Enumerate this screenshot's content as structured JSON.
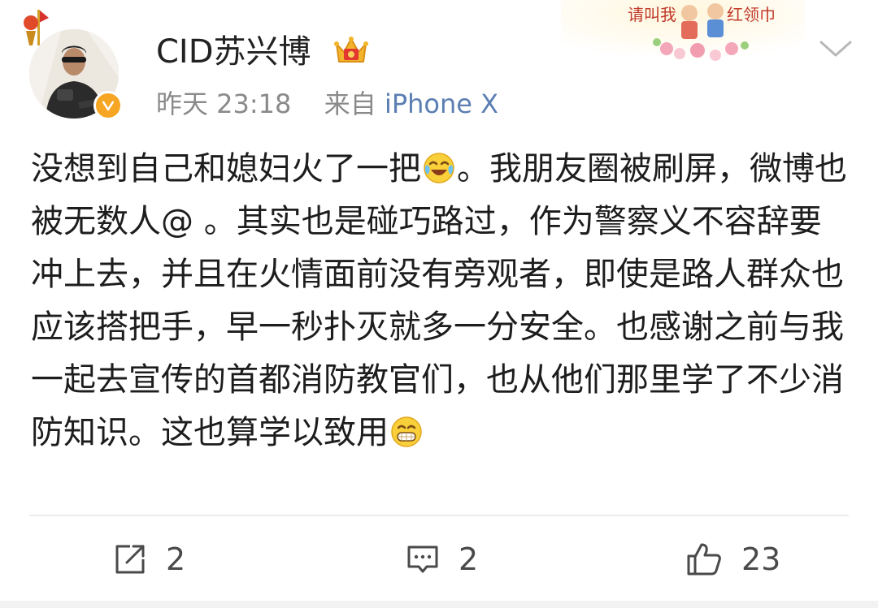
{
  "post": {
    "author": "CID苏兴博",
    "time": "昨天 23:18",
    "source_prefix": "来自",
    "source": "iPhone X",
    "content_parts": [
      "没想到自己和媳妇火了一把",
      "。我朋友圈被刷屏，微博也被无数人@ 。其实也是碰巧路过，作为警察义不容辞要冲上去，并且在火情面前没有旁观者，即使是路人群众也应该搭把手，早一秒扑灭就多一分安全。也感谢之前与我一起去宣传的首都消防教官们，也从他们那里学了不少消防知识。这也算学以致用"
    ],
    "emojis": [
      "laughing-tears-emoji",
      "grin-emoji"
    ],
    "sticker_text": [
      "请叫我",
      "红领巾"
    ]
  },
  "actions": {
    "forward_count": "2",
    "comment_count": "2",
    "like_count": "23"
  },
  "colors": {
    "verified_badge": "#f6a623",
    "source_link": "#5b7fb3",
    "meta_text": "#8a8a8a",
    "divider": "#ececec"
  },
  "icons": [
    "torch-flag-icon",
    "verified-badge-icon",
    "crown-icon",
    "chevron-down-icon",
    "forward-icon",
    "comment-icon",
    "like-icon"
  ]
}
